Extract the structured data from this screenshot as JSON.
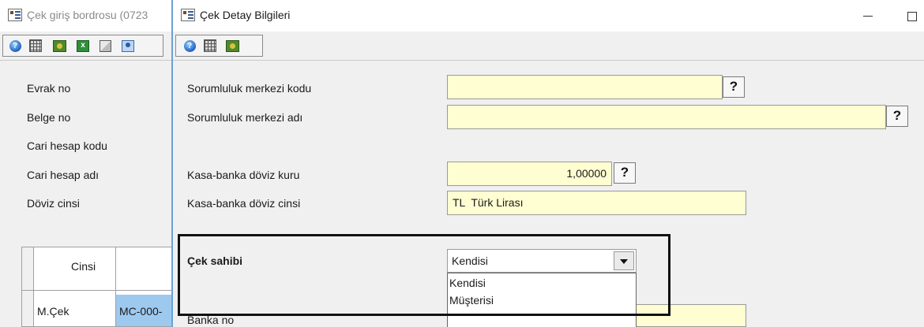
{
  "background_window": {
    "title": "Çek giriş bordrosu (0723",
    "toolbar_icons": [
      "help-icon",
      "calculator-icon",
      "money-icon",
      "excel-icon",
      "home-icon",
      "person-icon"
    ],
    "labels": {
      "evrak_no": "Evrak no",
      "belge_no": "Belge no",
      "cari_hesap_kodu": "Cari hesap kodu",
      "cari_hesap_adi": "Cari hesap adı",
      "doviz_cinsi": "Döviz cinsi"
    },
    "grid": {
      "column_header": "Cinsi",
      "row": {
        "type": "M.Çek",
        "code": "MC-000-"
      }
    }
  },
  "foreground_window": {
    "title": "Çek Detay Bilgileri",
    "toolbar_icons": [
      "help-icon",
      "calculator-icon",
      "money-icon"
    ],
    "fields": {
      "sorumluluk_merkezi_kodu": {
        "label": "Sorumluluk merkezi kodu",
        "value": "",
        "lookup": "?"
      },
      "sorumluluk_merkezi_adi": {
        "label": "Sorumluluk merkezi adı",
        "value": "",
        "lookup": "?"
      },
      "kasa_banka_doviz_kuru": {
        "label": "Kasa-banka döviz kuru",
        "value": "1,00000",
        "lookup": "?"
      },
      "kasa_banka_doviz_cinsi": {
        "label": "Kasa-banka döviz cinsi",
        "value": "TL  Türk Lirası"
      },
      "cek_sahibi": {
        "label": "Çek sahibi",
        "value": "Kendisi",
        "options": [
          "Kendisi",
          "Müşterisi"
        ]
      },
      "banka_no": {
        "label": "Banka no"
      }
    }
  },
  "colors": {
    "input_background": "#fffed2",
    "selected_cell": "#9ec9ef",
    "window_border": "#6aa2d6",
    "form_background": "#f0f0f0"
  }
}
